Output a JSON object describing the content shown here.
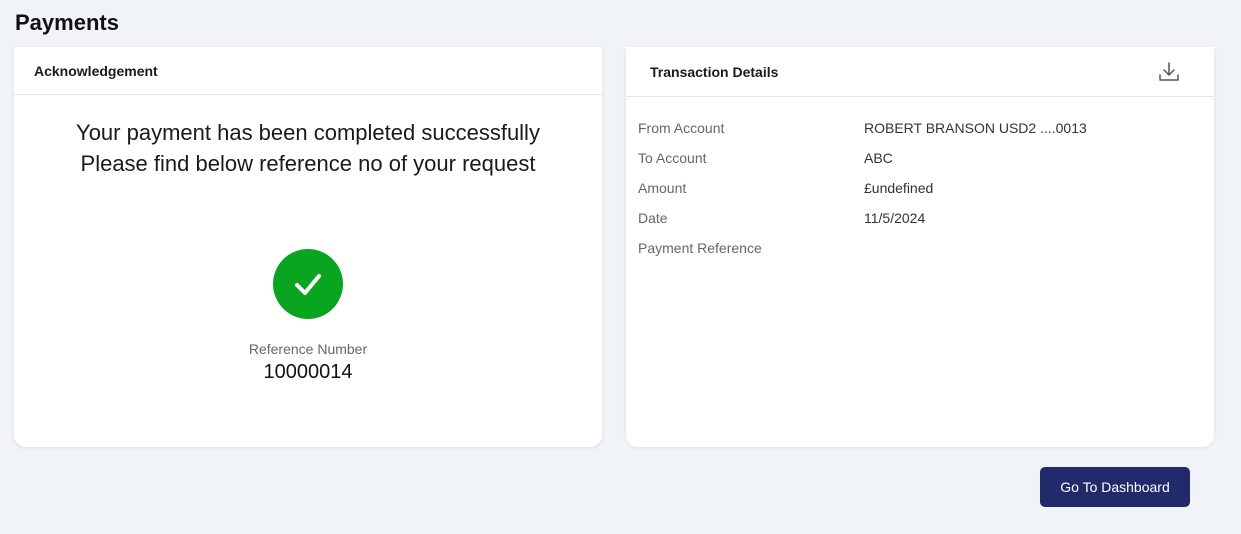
{
  "page": {
    "title": "Payments"
  },
  "acknowledgement": {
    "header": "Acknowledgement",
    "message_line1": "Your payment has been completed successfully",
    "message_line2": "Please find below reference no of your request",
    "reference_label": "Reference Number",
    "reference_number": "10000014",
    "success_color": "#0aa520",
    "icon": "check-icon"
  },
  "transaction": {
    "header": "Transaction Details",
    "download_icon": "download-icon",
    "rows": [
      {
        "label": "From Account",
        "value": "ROBERT BRANSON USD2 ....0013"
      },
      {
        "label": "To Account",
        "value": "ABC"
      },
      {
        "label": "Amount",
        "value": "£undefined"
      },
      {
        "label": "Date",
        "value": "11/5/2024"
      },
      {
        "label": "Payment Reference",
        "value": ""
      }
    ]
  },
  "actions": {
    "dashboard_label": "Go To Dashboard",
    "button_color": "#232a6b"
  }
}
